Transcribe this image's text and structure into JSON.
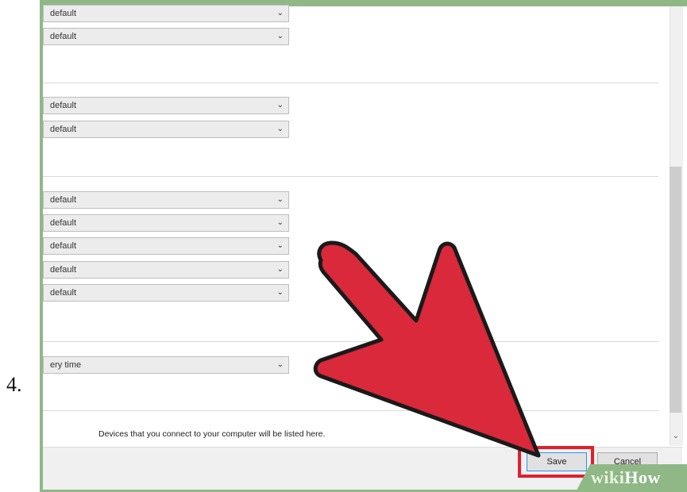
{
  "step": {
    "number": "4."
  },
  "dropdowns": [
    {
      "value": "default"
    },
    {
      "value": "default"
    },
    {
      "value": "default"
    },
    {
      "value": "default"
    },
    {
      "value": "default"
    },
    {
      "value": "default"
    },
    {
      "value": "default"
    },
    {
      "value": "default"
    },
    {
      "value": "default"
    },
    {
      "value": "ery time"
    }
  ],
  "devices": {
    "empty_message": "Devices that you connect to your computer will be listed here."
  },
  "footer": {
    "save_label": "Save",
    "cancel_label": "Cancel"
  },
  "watermark": {
    "part1": "wiki",
    "part2": "How"
  },
  "colors": {
    "frame": "#8fb886",
    "highlight": "#e0202e",
    "arrow": "#d9293a"
  }
}
